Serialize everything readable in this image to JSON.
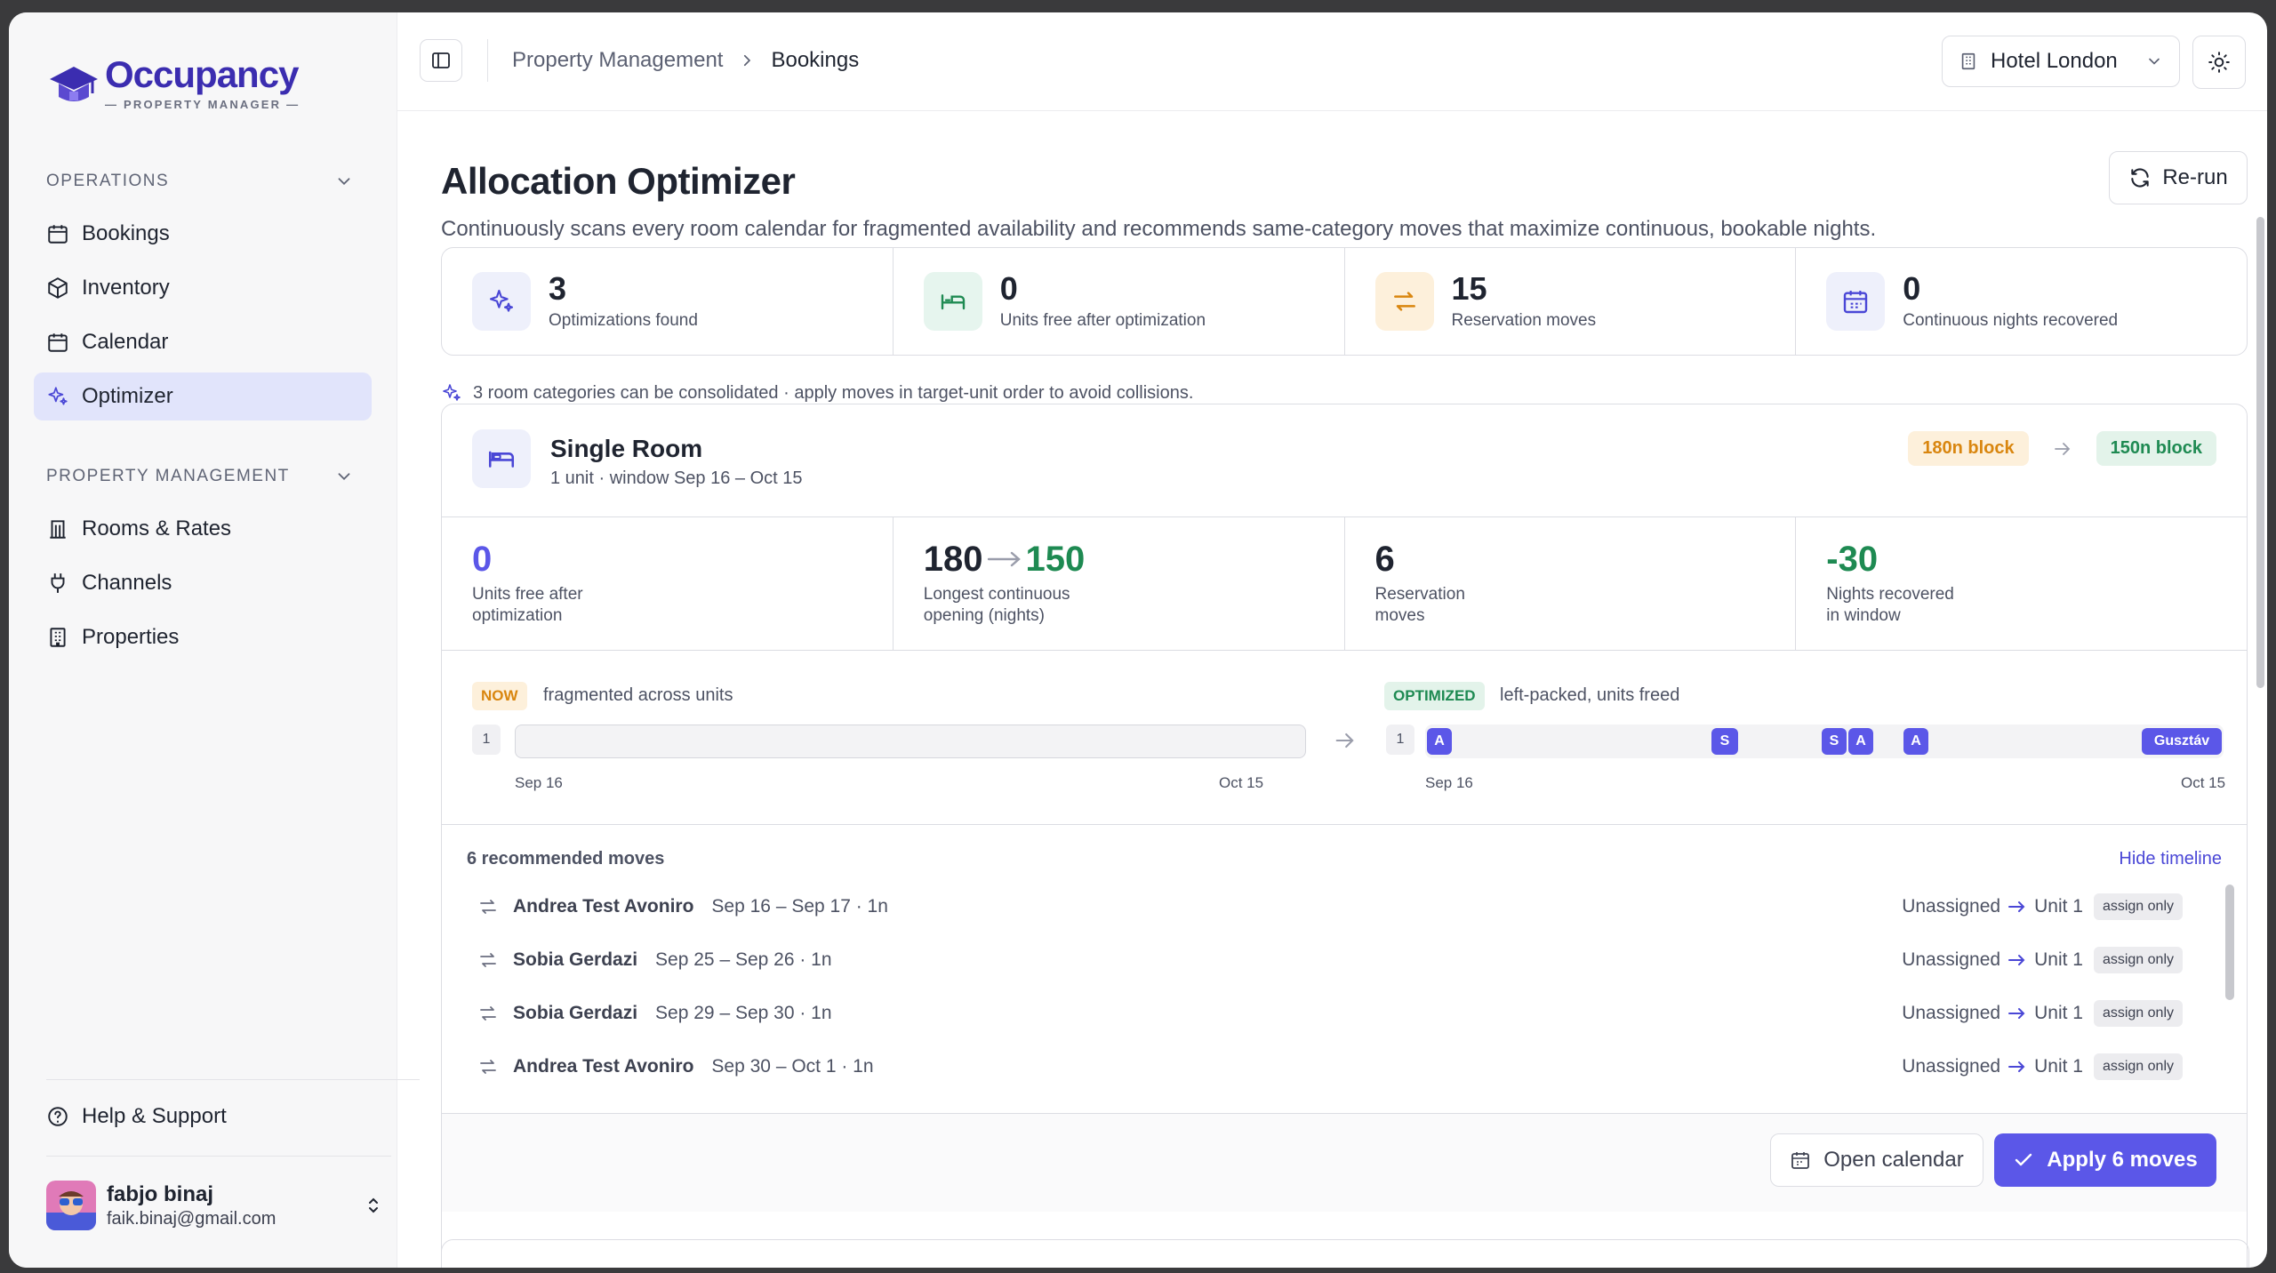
{
  "brand": {
    "name": "Occupancy",
    "subtitle": "— PROPERTY MANAGER —"
  },
  "sidebar": {
    "operations_label": "OPERATIONS",
    "operations_items": [
      {
        "label": "Bookings",
        "icon": "calendar-icon"
      },
      {
        "label": "Inventory",
        "icon": "box-icon"
      },
      {
        "label": "Calendar",
        "icon": "calendar-icon"
      },
      {
        "label": "Optimizer",
        "icon": "sparkles-icon",
        "active": true
      }
    ],
    "property_label": "PROPERTY MANAGEMENT",
    "property_items": [
      {
        "label": "Rooms & Rates",
        "icon": "columns-icon"
      },
      {
        "label": "Channels",
        "icon": "plug-icon"
      },
      {
        "label": "Properties",
        "icon": "building-icon"
      }
    ],
    "help_label": "Help & Support",
    "user": {
      "name": "fabjo binaj",
      "email": "faik.binaj@gmail.com"
    }
  },
  "topbar": {
    "breadcrumb": [
      "Property Management",
      "Bookings"
    ],
    "hotel": "Hotel London"
  },
  "page": {
    "title": "Allocation Optimizer",
    "description": "Continuously scans every room calendar for fragmented availability and recommends same-category moves that maximize continuous, bookable nights.",
    "rerun_label": "Re-run"
  },
  "stats": [
    {
      "value": "3",
      "label": "Optimizations found",
      "icon": "sparkles-icon"
    },
    {
      "value": "0",
      "label": "Units free after optimization",
      "icon": "bed-icon"
    },
    {
      "value": "15",
      "label": "Reservation moves",
      "icon": "swap-icon"
    },
    {
      "value": "0",
      "label": "Continuous nights recovered",
      "icon": "calendar-icon"
    }
  ],
  "hint": "3 room categories can be consolidated · apply moves in target-unit order to avoid collisions.",
  "card": {
    "room_name": "Single Room",
    "room_sub": "1 unit · window Sep 16 – Oct 15",
    "block_before": "180n block",
    "block_after": "150n block",
    "metrics": [
      {
        "value": "0",
        "label": "Units free after optimization"
      },
      {
        "value_from": "180",
        "value_to": "150",
        "label": "Longest continuous opening (nights)"
      },
      {
        "value": "6",
        "label": "Reservation moves"
      },
      {
        "value": "-30",
        "label": "Nights recovered in window"
      }
    ],
    "timeline": {
      "now_tag": "NOW",
      "now_desc": "fragmented across units",
      "opt_tag": "OPTIMIZED",
      "opt_desc": "left-packed, units freed",
      "unit_label": "1",
      "start": "Sep 16",
      "end": "Oct 15",
      "chips": [
        "A",
        "S",
        "S",
        "A",
        "A",
        "Gusztáv"
      ]
    },
    "moves_title": "6 recommended moves",
    "hide_timeline": "Hide timeline",
    "moves": [
      {
        "guest": "Andrea Test Avoniro",
        "dates": "Sep 16 – Sep 17 · 1n",
        "from": "Unassigned",
        "to": "Unit 1",
        "tag": "assign only"
      },
      {
        "guest": "Sobia Gerdazi",
        "dates": "Sep 25 – Sep 26 · 1n",
        "from": "Unassigned",
        "to": "Unit 1",
        "tag": "assign only"
      },
      {
        "guest": "Sobia Gerdazi",
        "dates": "Sep 29 – Sep 30 · 1n",
        "from": "Unassigned",
        "to": "Unit 1",
        "tag": "assign only"
      },
      {
        "guest": "Andrea Test Avoniro",
        "dates": "Sep 30 – Oct 1 · 1n",
        "from": "Unassigned",
        "to": "Unit 1",
        "tag": "assign only"
      }
    ],
    "open_calendar": "Open calendar",
    "apply_label": "Apply 6 moves"
  },
  "colors": {
    "accent": "#5b57e8",
    "brand": "#3b2db0",
    "orange": "#d9860f",
    "green": "#1e8a52"
  }
}
